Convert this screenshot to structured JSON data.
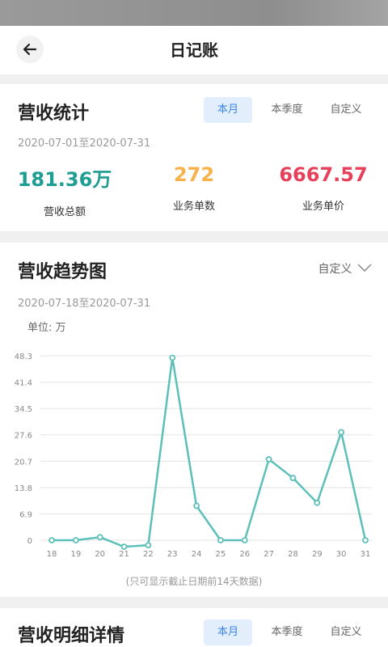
{
  "header": {
    "title": "日记账"
  },
  "revenue_stats": {
    "title": "营收统计",
    "tabs": [
      "本月",
      "本季度",
      "自定义"
    ],
    "active_tab": "本月",
    "date_range": "2020-07-01至2020-07-31",
    "kpis": [
      {
        "value": "181.36万",
        "label": "营收总额",
        "color": "#1e9e93"
      },
      {
        "value": "272",
        "label": "业务单数",
        "color": "#f7b24b"
      },
      {
        "value": "6667.57",
        "label": "业务单价",
        "color": "#e6405a"
      }
    ]
  },
  "trend": {
    "title": "营收趋势图",
    "filter_label": "自定义",
    "date_range": "2020-07-18至2020-07-31",
    "unit_label": "单位: 万",
    "note": "(只可显示截止日期前14天数据)"
  },
  "chart_data": {
    "type": "line",
    "x": [
      "18",
      "19",
      "20",
      "21",
      "22",
      "23",
      "24",
      "25",
      "26",
      "27",
      "28",
      "29",
      "30",
      "31"
    ],
    "series": [
      {
        "values": [
          0,
          0,
          0.8,
          -1.7,
          -1.3,
          47.8,
          9.0,
          0,
          0,
          21.2,
          16.3,
          9.8,
          28.3,
          0
        ],
        "color": "#5cc0b9"
      }
    ],
    "yticks": [
      "0",
      "6.9",
      "13.8",
      "20.7",
      "27.6",
      "34.5",
      "41.4",
      "48.3"
    ],
    "ylim": [
      0,
      48.3
    ],
    "grid": true
  },
  "details": {
    "title": "营收明细详情",
    "tabs": [
      "本月",
      "本季度",
      "自定义"
    ],
    "active_tab": "本月"
  }
}
